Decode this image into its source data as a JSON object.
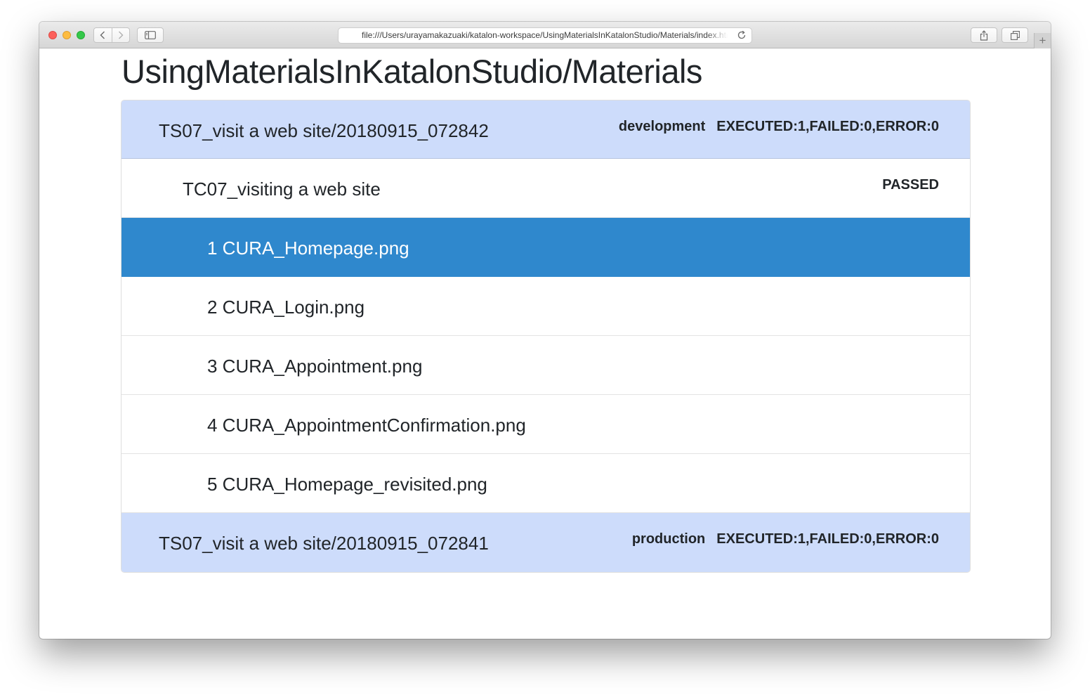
{
  "browser": {
    "url": "file:///Users/urayamakazuaki/katalon-workspace/UsingMaterialsInKatalonStudio/Materials/index.html",
    "new_tab_label": "+"
  },
  "page": {
    "title": "UsingMaterialsInKatalonStudio/Materials"
  },
  "suites": [
    {
      "name": "TS07_visit a web site/20180915_072842",
      "environment": "development",
      "summary": "EXECUTED:1,FAILED:0,ERROR:0",
      "test_case": {
        "name": "TC07_visiting a web site",
        "status": "PASSED",
        "materials": [
          {
            "label": "1 CURA_Homepage.png",
            "selected": true
          },
          {
            "label": "2 CURA_Login.png",
            "selected": false
          },
          {
            "label": "3 CURA_Appointment.png",
            "selected": false
          },
          {
            "label": "4 CURA_AppointmentConfirmation.png",
            "selected": false
          },
          {
            "label": "5 CURA_Homepage_revisited.png",
            "selected": false
          }
        ]
      }
    },
    {
      "name": "TS07_visit a web site/20180915_072841",
      "environment": "production",
      "summary": "EXECUTED:1,FAILED:0,ERROR:0"
    }
  ],
  "colors": {
    "suite_background": "#cddcfb",
    "selected_background": "#2f88cd",
    "text": "#212529"
  }
}
